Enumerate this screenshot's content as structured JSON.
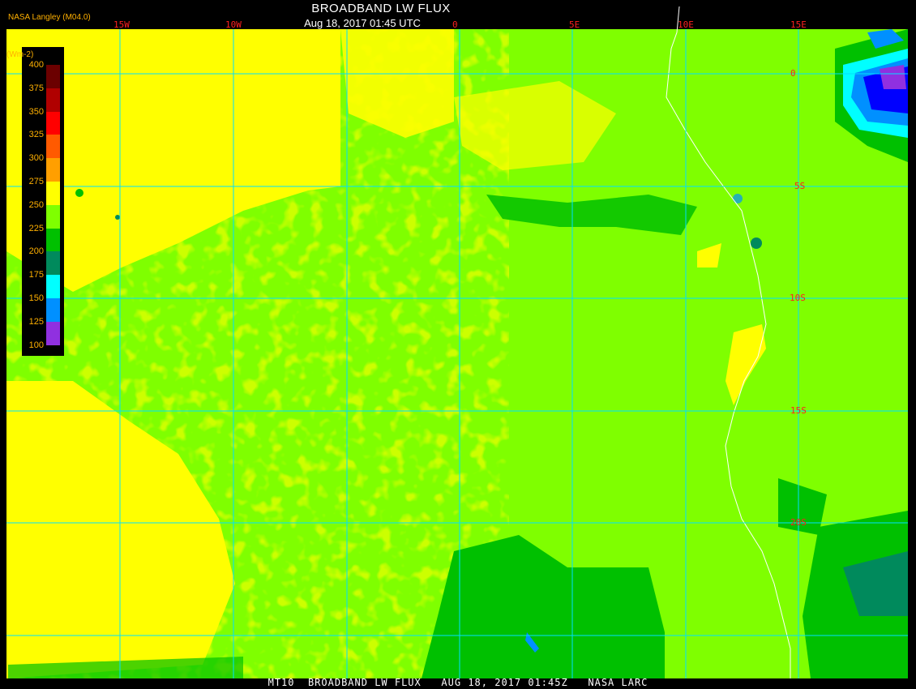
{
  "header": {
    "org": "NASA Langley (M04.0)",
    "title": "BROADBAND LW FLUX",
    "time": "Aug 18, 2017 01:45 UTC"
  },
  "footer": {
    "text": "MT10  BROADBAND LW FLUX   AUG 18, 2017 01:45Z   NASA LARC"
  },
  "legend": {
    "unit": "(Wm-2)",
    "ticks": [
      "400",
      "375",
      "350",
      "325",
      "300",
      "275",
      "250",
      "225",
      "200",
      "175",
      "150",
      "125",
      "100"
    ],
    "colors": [
      "#6b0000",
      "#b00000",
      "#ff0000",
      "#ff5a00",
      "#ff9f00",
      "#ffff00",
      "#7fff00",
      "#00c000",
      "#008a5c",
      "#00ffff",
      "#0090ff",
      "#0000ff",
      "#9030e0"
    ]
  },
  "grid": {
    "lon_labels": [
      "15W",
      "10W",
      "0",
      "5E",
      "10E",
      "15E"
    ],
    "lat_labels": [
      "0",
      "5S",
      "10S",
      "15S",
      "20S"
    ]
  },
  "colors": {
    "background": "#000000",
    "grid": "#00e0ff",
    "coast": "#ffffff",
    "label": "#ff2020",
    "legend_text": "#ffb000"
  }
}
